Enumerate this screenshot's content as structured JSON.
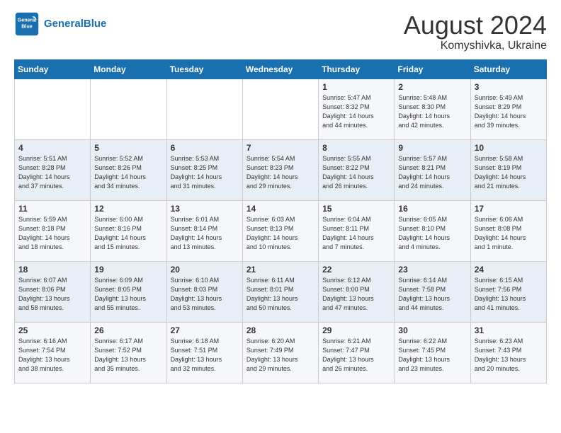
{
  "logo": {
    "line1": "General",
    "line2": "Blue"
  },
  "header": {
    "month": "August 2024",
    "location": "Komyshivka, Ukraine"
  },
  "days_of_week": [
    "Sunday",
    "Monday",
    "Tuesday",
    "Wednesday",
    "Thursday",
    "Friday",
    "Saturday"
  ],
  "weeks": [
    [
      {
        "day": "",
        "info": ""
      },
      {
        "day": "",
        "info": ""
      },
      {
        "day": "",
        "info": ""
      },
      {
        "day": "",
        "info": ""
      },
      {
        "day": "1",
        "info": "Sunrise: 5:47 AM\nSunset: 8:32 PM\nDaylight: 14 hours\nand 44 minutes."
      },
      {
        "day": "2",
        "info": "Sunrise: 5:48 AM\nSunset: 8:30 PM\nDaylight: 14 hours\nand 42 minutes."
      },
      {
        "day": "3",
        "info": "Sunrise: 5:49 AM\nSunset: 8:29 PM\nDaylight: 14 hours\nand 39 minutes."
      }
    ],
    [
      {
        "day": "4",
        "info": "Sunrise: 5:51 AM\nSunset: 8:28 PM\nDaylight: 14 hours\nand 37 minutes."
      },
      {
        "day": "5",
        "info": "Sunrise: 5:52 AM\nSunset: 8:26 PM\nDaylight: 14 hours\nand 34 minutes."
      },
      {
        "day": "6",
        "info": "Sunrise: 5:53 AM\nSunset: 8:25 PM\nDaylight: 14 hours\nand 31 minutes."
      },
      {
        "day": "7",
        "info": "Sunrise: 5:54 AM\nSunset: 8:23 PM\nDaylight: 14 hours\nand 29 minutes."
      },
      {
        "day": "8",
        "info": "Sunrise: 5:55 AM\nSunset: 8:22 PM\nDaylight: 14 hours\nand 26 minutes."
      },
      {
        "day": "9",
        "info": "Sunrise: 5:57 AM\nSunset: 8:21 PM\nDaylight: 14 hours\nand 24 minutes."
      },
      {
        "day": "10",
        "info": "Sunrise: 5:58 AM\nSunset: 8:19 PM\nDaylight: 14 hours\nand 21 minutes."
      }
    ],
    [
      {
        "day": "11",
        "info": "Sunrise: 5:59 AM\nSunset: 8:18 PM\nDaylight: 14 hours\nand 18 minutes."
      },
      {
        "day": "12",
        "info": "Sunrise: 6:00 AM\nSunset: 8:16 PM\nDaylight: 14 hours\nand 15 minutes."
      },
      {
        "day": "13",
        "info": "Sunrise: 6:01 AM\nSunset: 8:14 PM\nDaylight: 14 hours\nand 13 minutes."
      },
      {
        "day": "14",
        "info": "Sunrise: 6:03 AM\nSunset: 8:13 PM\nDaylight: 14 hours\nand 10 minutes."
      },
      {
        "day": "15",
        "info": "Sunrise: 6:04 AM\nSunset: 8:11 PM\nDaylight: 14 hours\nand 7 minutes."
      },
      {
        "day": "16",
        "info": "Sunrise: 6:05 AM\nSunset: 8:10 PM\nDaylight: 14 hours\nand 4 minutes."
      },
      {
        "day": "17",
        "info": "Sunrise: 6:06 AM\nSunset: 8:08 PM\nDaylight: 14 hours\nand 1 minute."
      }
    ],
    [
      {
        "day": "18",
        "info": "Sunrise: 6:07 AM\nSunset: 8:06 PM\nDaylight: 13 hours\nand 58 minutes."
      },
      {
        "day": "19",
        "info": "Sunrise: 6:09 AM\nSunset: 8:05 PM\nDaylight: 13 hours\nand 55 minutes."
      },
      {
        "day": "20",
        "info": "Sunrise: 6:10 AM\nSunset: 8:03 PM\nDaylight: 13 hours\nand 53 minutes."
      },
      {
        "day": "21",
        "info": "Sunrise: 6:11 AM\nSunset: 8:01 PM\nDaylight: 13 hours\nand 50 minutes."
      },
      {
        "day": "22",
        "info": "Sunrise: 6:12 AM\nSunset: 8:00 PM\nDaylight: 13 hours\nand 47 minutes."
      },
      {
        "day": "23",
        "info": "Sunrise: 6:14 AM\nSunset: 7:58 PM\nDaylight: 13 hours\nand 44 minutes."
      },
      {
        "day": "24",
        "info": "Sunrise: 6:15 AM\nSunset: 7:56 PM\nDaylight: 13 hours\nand 41 minutes."
      }
    ],
    [
      {
        "day": "25",
        "info": "Sunrise: 6:16 AM\nSunset: 7:54 PM\nDaylight: 13 hours\nand 38 minutes."
      },
      {
        "day": "26",
        "info": "Sunrise: 6:17 AM\nSunset: 7:52 PM\nDaylight: 13 hours\nand 35 minutes."
      },
      {
        "day": "27",
        "info": "Sunrise: 6:18 AM\nSunset: 7:51 PM\nDaylight: 13 hours\nand 32 minutes."
      },
      {
        "day": "28",
        "info": "Sunrise: 6:20 AM\nSunset: 7:49 PM\nDaylight: 13 hours\nand 29 minutes."
      },
      {
        "day": "29",
        "info": "Sunrise: 6:21 AM\nSunset: 7:47 PM\nDaylight: 13 hours\nand 26 minutes."
      },
      {
        "day": "30",
        "info": "Sunrise: 6:22 AM\nSunset: 7:45 PM\nDaylight: 13 hours\nand 23 minutes."
      },
      {
        "day": "31",
        "info": "Sunrise: 6:23 AM\nSunset: 7:43 PM\nDaylight: 13 hours\nand 20 minutes."
      }
    ]
  ]
}
